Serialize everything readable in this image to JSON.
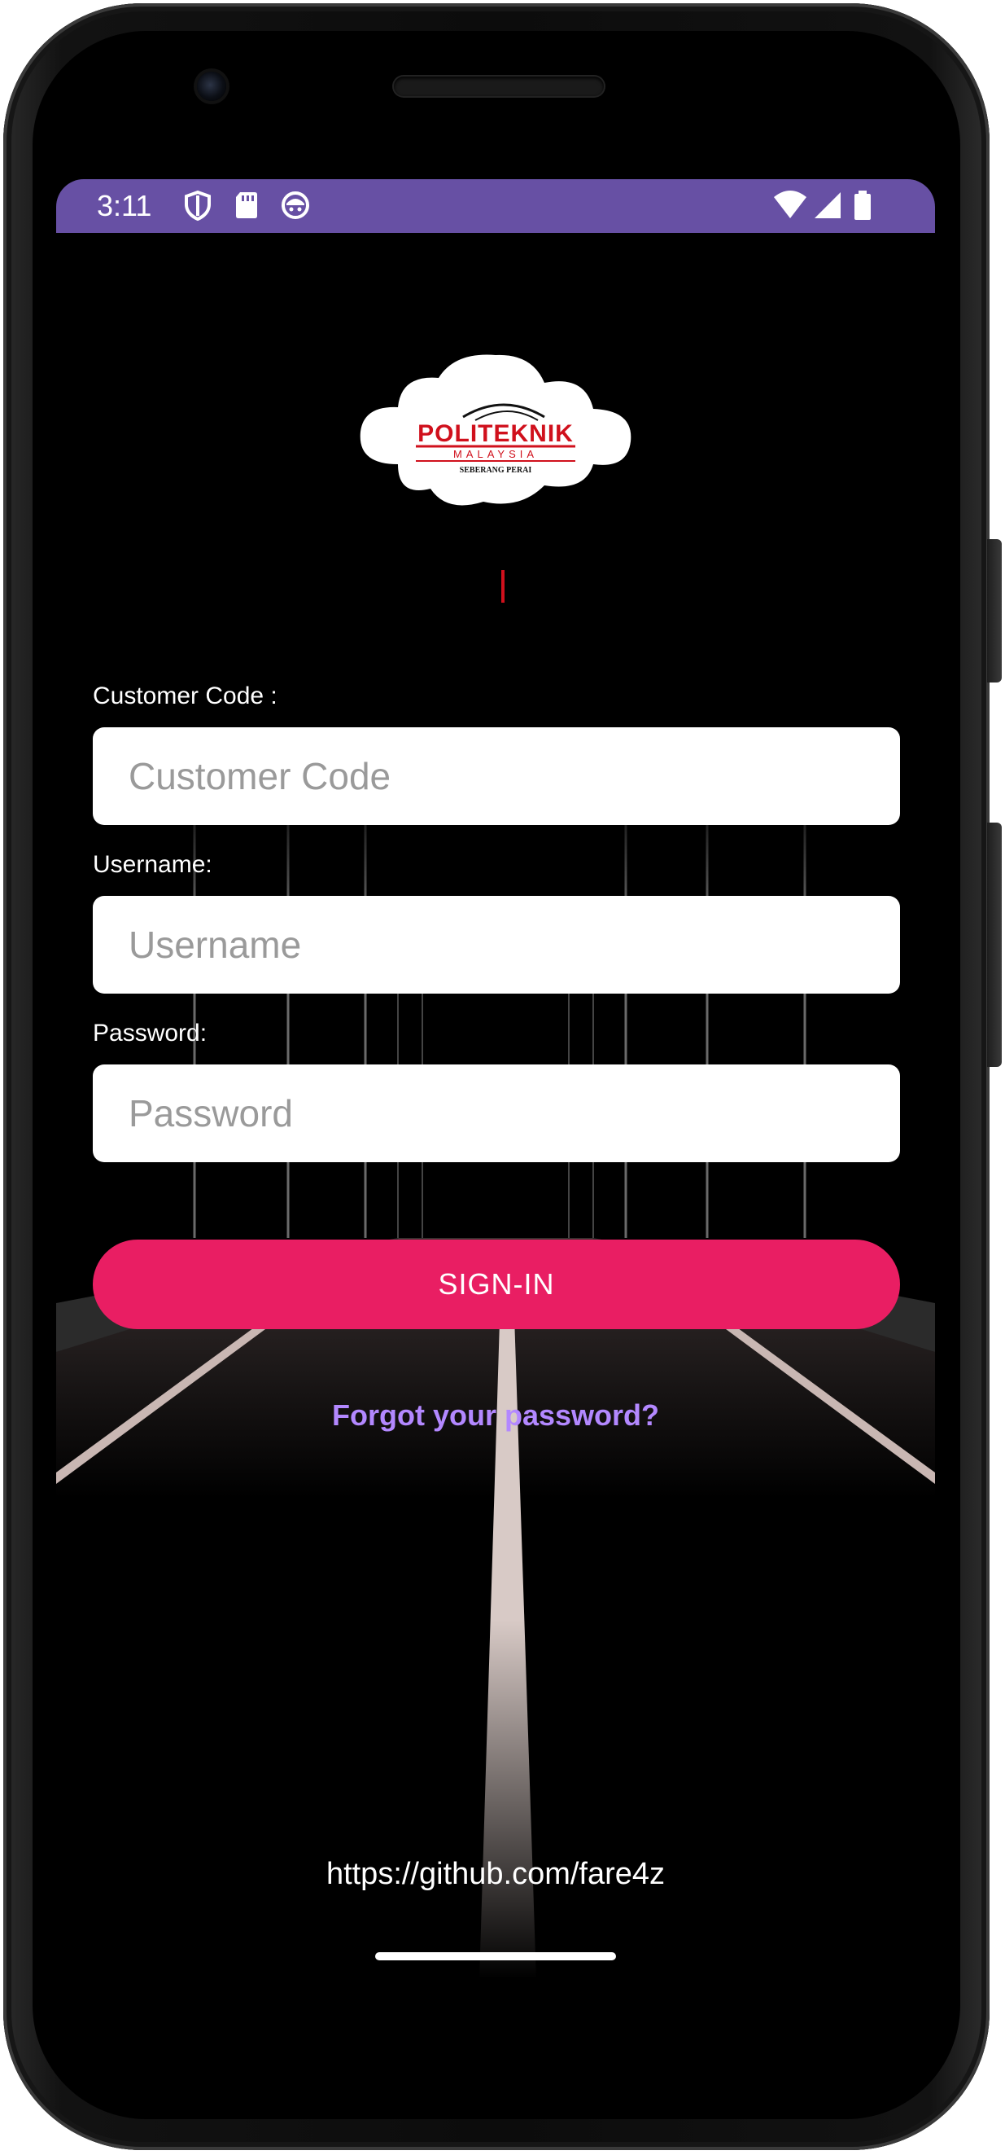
{
  "status_bar": {
    "time": "3:11",
    "icons_left": [
      "shield-icon",
      "sd-card-icon",
      "face-icon"
    ],
    "icons_right": [
      "wifi-icon",
      "signal-icon",
      "battery-icon"
    ],
    "background_color": "#6750a4"
  },
  "logo": {
    "brand": "POLITEKNIK",
    "country": "MALAYSIA",
    "campus": "SEBERANG PERAI",
    "brand_color": "#d0101c"
  },
  "form": {
    "customer_code": {
      "label": "Customer Code :",
      "placeholder": "Customer Code",
      "value": ""
    },
    "username": {
      "label": "Username:",
      "placeholder": "Username",
      "value": ""
    },
    "password": {
      "label": "Password:",
      "placeholder": "Password",
      "value": ""
    },
    "signin_label": "SIGN-IN",
    "forgot_label": "Forgot your password?"
  },
  "footer": {
    "url": "https://github.com/fare4z"
  },
  "colors": {
    "accent": "#e91e63",
    "link": "#b388ff",
    "screen_background": "#000000"
  }
}
